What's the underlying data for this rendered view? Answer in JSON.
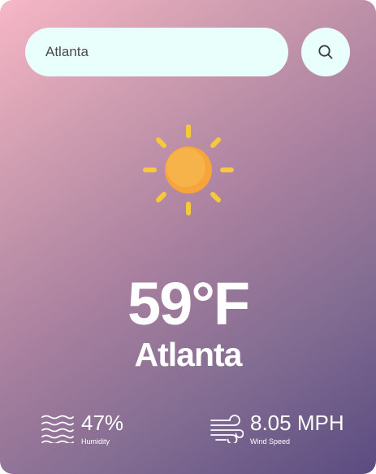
{
  "search": {
    "value": "Atlanta",
    "button_icon": "search-icon"
  },
  "weather": {
    "condition_icon": "sun-icon",
    "temperature": "59°F",
    "city": "Atlanta"
  },
  "details": {
    "humidity": {
      "icon": "humidity-waves-icon",
      "value": "47%",
      "label": "Humidity"
    },
    "wind": {
      "icon": "wind-icon",
      "value": "8.05 MPH",
      "label": "Wind Speed"
    }
  },
  "colors": {
    "gradient_start": "#f7b7c6",
    "gradient_end": "#5a4b80",
    "input_background": "#e9fffb",
    "sun_core": "#f7a43a",
    "sun_rays": "#f6c93b"
  }
}
